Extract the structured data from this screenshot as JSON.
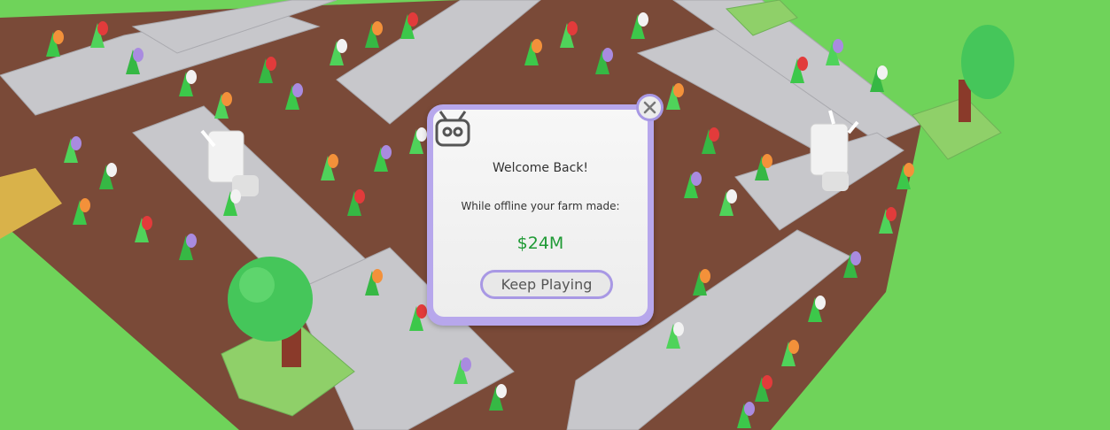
{
  "modal": {
    "icon": "robot-icon",
    "title": "Welcome Back!",
    "message": "While offline your farm made:",
    "earnings": "$24M",
    "button_label": "Keep Playing",
    "close_icon": "close-icon"
  },
  "colors": {
    "grass": "#6fd35a",
    "soil": "#7a4a38",
    "path": "#c7c7cb",
    "modal_border": "#a898e4",
    "earnings_green": "#1f9a35"
  }
}
